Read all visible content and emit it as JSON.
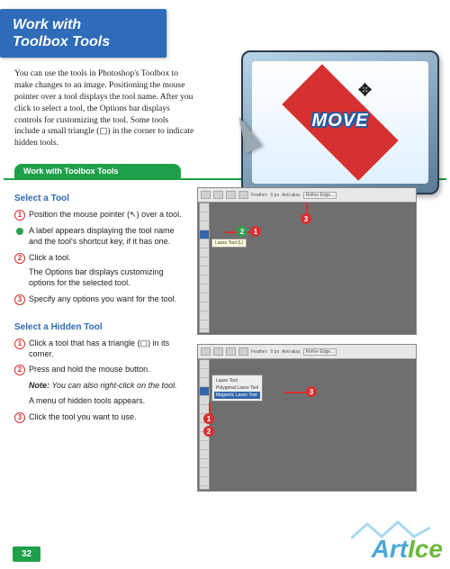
{
  "title_line1": "Work with",
  "title_line2": "Toolbox Tools",
  "intro": "You can use the tools in Photoshop's Toolbox to make changes to an image. Positioning the mouse pointer over a tool displays the tool name. After you click to select a tool, the Options bar displays controls for customizing the tool. Some tools include a small triangle (▢) in the corner to indicate hidden tools.",
  "monitor_label": "MOVE",
  "section_bar": "Work with Toolbox Tools",
  "select_tool": {
    "heading": "Select a Tool",
    "step1": "Position the mouse pointer (↖) over a tool.",
    "bullet1": "A label appears displaying the tool name and the tool's shortcut key, if it has one.",
    "step2": "Click a tool.",
    "sub2": "The Options bar displays customizing options for the selected tool.",
    "step3": "Specify any options you want for the tool."
  },
  "select_hidden": {
    "heading": "Select a Hidden Tool",
    "step1": "Click a tool that has a triangle (▢) in its corner.",
    "step2": "Press and hold the mouse button.",
    "note_label": "Note:",
    "note": "You can also right-click on the tool.",
    "sub2": "A menu of hidden tools appears.",
    "step3": "Click the tool you want to use."
  },
  "options_bar": {
    "feather_label": "Feather:",
    "feather_val": "0 px",
    "aa": "Anti-alias",
    "refine": "Refine Edge..."
  },
  "tooltip1": "Lasso Tool (L)",
  "flyout": {
    "a": "Lasso Tool",
    "b": "Polygonal Lasso Tool",
    "c": "Magnetic Lasso Tool"
  },
  "callout_nums": {
    "n1": "1",
    "n2": "2",
    "n3": "3"
  },
  "page_number": "32",
  "watermark_a": "Art",
  "watermark_b": "Ice"
}
